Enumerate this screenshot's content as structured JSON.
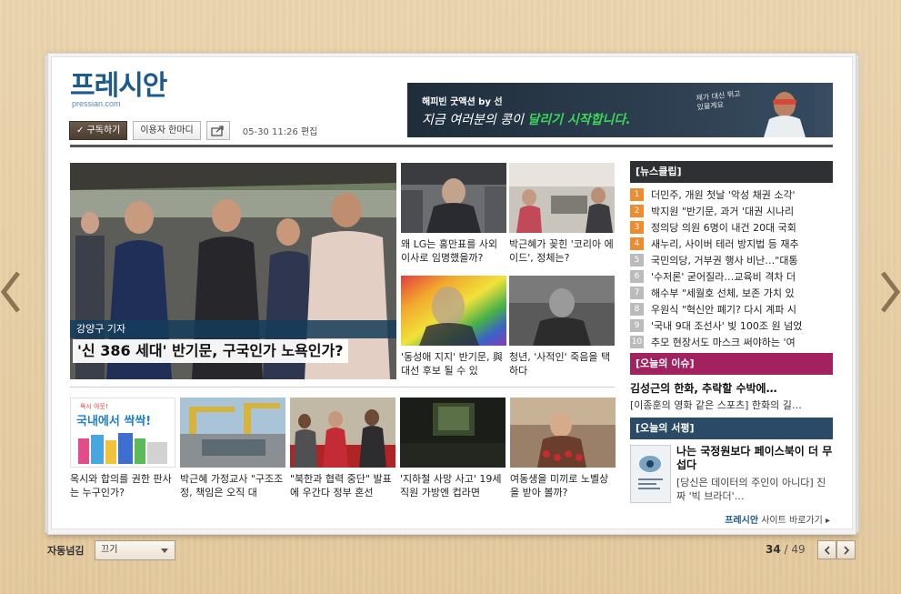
{
  "logo": {
    "text": "프레시안",
    "sub": "pressian.com"
  },
  "toolbar": {
    "subscribe_label": "✓ 구독하기",
    "comment_label": "이용자 한마디",
    "date": "05-30 11:26 편집"
  },
  "banner": {
    "small": "해피빈 굿액션 by 선",
    "main_prefix": "지금 여러분의 콩이 ",
    "main_highlight": "달리기 시작합니다.",
    "side": "제가 대신 뛰고 있을게요"
  },
  "main_story": {
    "reporter": "강양구 기자",
    "headline": "'신 386 세대' 반기문, 구국인가 노욕인가?"
  },
  "mid_stories": [
    {
      "caption": "왜 LG는 홍만표를 사외이사로 임명했을까?"
    },
    {
      "caption": "박근혜가 꽂힌 '코리아 에이드', 정체는?"
    },
    {
      "caption": "'동성애 지지' 반기문, 與 대선 후보 될 수 있"
    },
    {
      "caption": "청년, '사적인' 죽음을 택하다"
    }
  ],
  "bottom_stories": [
    {
      "caption": "옥시와 합의를 권한 판사는 누구인가?",
      "ad_text": "국내에서 싹싹!",
      "ad_top": "옥시 아웃!"
    },
    {
      "caption": "박근혜 가정교사 \"구조조정, 책임은 오직 대"
    },
    {
      "caption": "\"북한과 협력 중단\" 발표에 우간다 정부 혼선"
    },
    {
      "caption": "'지하철 사망 사고' 19세 직원 가방엔 컵라면"
    },
    {
      "caption": "여동생을 미끼로 노벨상을 받아 볼까?"
    }
  ],
  "sidebar": {
    "news_clip_title": "[뉴스클립]",
    "news_clip": [
      {
        "num": "1",
        "text": "더민주, 개원 첫날 '악성 채권 소각'"
      },
      {
        "num": "2",
        "text": "박지원 \"반기문, 과거 '대권 시나리"
      },
      {
        "num": "3",
        "text": "정의당 의원 6명이 내건 20대 국회"
      },
      {
        "num": "4",
        "text": "새누리, 사이버 테러 방지법 등 재추"
      },
      {
        "num": "5",
        "text": "국민의당, 거부권 행사 비난…\"대통"
      },
      {
        "num": "6",
        "text": "'수저론' 굳어질라…교육비 격차 더"
      },
      {
        "num": "7",
        "text": "해수부 \"세월호 선체, 보존 가치 있"
      },
      {
        "num": "8",
        "text": "우원식 \"혁신안 폐기? 다시 계파 시"
      },
      {
        "num": "9",
        "text": "'국내 9대 조선사' 빚 100조 원 넘었"
      },
      {
        "num": "10",
        "text": "추모 현장서도 마스크 써야하는 '여"
      }
    ],
    "issue_title": "[오늘의 이슈]",
    "issue_headline": "김성근의 한화, 추락할 수박에…",
    "issue_sub": "[이종훈의 영화 같은 스포츠] 한화의 길…",
    "review_title": "[오늘의 서평]",
    "review_headline": "나는 국정원보다 페이스북이 더 무섭다",
    "review_desc": "[당신은 데이터의 주인이 아니다] 진짜 '빅 브라더'…"
  },
  "footer": {
    "brand": "프레시안",
    "link": " 사이트 바로가기 ▸"
  },
  "controls": {
    "auto_label": "자동넘김",
    "auto_value": "끄기",
    "page_current": "34",
    "page_total": " / 49"
  },
  "colors": {
    "logo": "#1e5a8c",
    "accent_orange": "#f08c2e",
    "issue_header": "#a02360",
    "review_header": "#2a4a68"
  }
}
